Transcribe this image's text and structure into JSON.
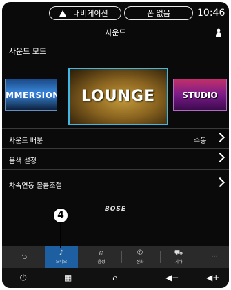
{
  "status_bar": {
    "navigation_label": "내비게이션",
    "phone_label": "폰 없음",
    "time": "10:46"
  },
  "header": {
    "title": "사운드"
  },
  "sound_mode": {
    "label": "사운드 모드",
    "cards": [
      {
        "label": "IMMERSION"
      },
      {
        "label": "LOUNGE",
        "selected": true
      },
      {
        "label": "STUDIO"
      }
    ]
  },
  "settings": {
    "rows": [
      {
        "label": "사운드 배분",
        "value": "수동"
      },
      {
        "label": "음색 설정"
      },
      {
        "label": "차속연동 볼륨조절"
      }
    ]
  },
  "brand_logo": "BOSE",
  "tabs": [
    {
      "icon": "back-arrow-icon",
      "label": ""
    },
    {
      "icon": "music-note-icon",
      "label": "오디오",
      "active": true
    },
    {
      "icon": "voice-icon",
      "label": "음성"
    },
    {
      "icon": "phone-icon",
      "label": "전화"
    },
    {
      "icon": "car-icon",
      "label": "기타"
    },
    {
      "icon": "more-icon",
      "label": ""
    }
  ],
  "bottom_bar": [
    "power-icon",
    "grid-icon",
    "home-icon",
    "volume-down-icon",
    "volume-up-icon"
  ],
  "callout": {
    "number": "4"
  },
  "colors": {
    "accent": "#3fb8e8",
    "active_tab": "#1d5fa0",
    "background": "#0a0a0a"
  }
}
